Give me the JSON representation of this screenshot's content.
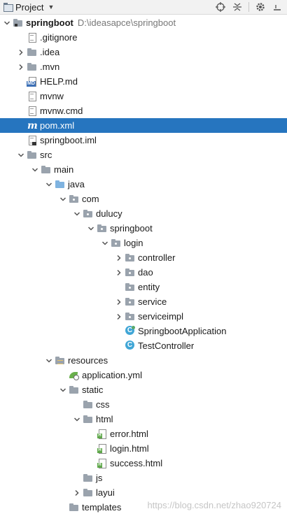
{
  "toolbar": {
    "title": "Project",
    "icons": [
      "project-icon",
      "dropdown-caret-icon",
      "crosshair-icon",
      "collapse-all-icon",
      "settings-gear-icon",
      "hide-icon"
    ]
  },
  "tree": [
    {
      "label": "springboot",
      "path": "D:\\ideasapce\\springboot",
      "depth": 0,
      "arrow": "down",
      "icon": "module-folder"
    },
    {
      "label": ".gitignore",
      "depth": 1,
      "arrow": "none",
      "icon": "text-file"
    },
    {
      "label": ".idea",
      "depth": 1,
      "arrow": "right",
      "icon": "folder"
    },
    {
      "label": ".mvn",
      "depth": 1,
      "arrow": "right",
      "icon": "folder"
    },
    {
      "label": "HELP.md",
      "depth": 1,
      "arrow": "none",
      "icon": "markdown-file"
    },
    {
      "label": "mvnw",
      "depth": 1,
      "arrow": "none",
      "icon": "text-file"
    },
    {
      "label": "mvnw.cmd",
      "depth": 1,
      "arrow": "none",
      "icon": "text-file"
    },
    {
      "label": "pom.xml",
      "depth": 1,
      "arrow": "none",
      "icon": "maven-file",
      "selected": true
    },
    {
      "label": "springboot.iml",
      "depth": 1,
      "arrow": "none",
      "icon": "iml-file"
    },
    {
      "label": "src",
      "depth": 1,
      "arrow": "down",
      "icon": "folder"
    },
    {
      "label": "main",
      "depth": 2,
      "arrow": "down",
      "icon": "folder"
    },
    {
      "label": "java",
      "depth": 3,
      "arrow": "down",
      "icon": "source-folder"
    },
    {
      "label": "com",
      "depth": 4,
      "arrow": "down",
      "icon": "package"
    },
    {
      "label": "dulucy",
      "depth": 5,
      "arrow": "down",
      "icon": "package"
    },
    {
      "label": "springboot",
      "depth": 6,
      "arrow": "down",
      "icon": "package"
    },
    {
      "label": "login",
      "depth": 7,
      "arrow": "down",
      "icon": "package"
    },
    {
      "label": "controller",
      "depth": 8,
      "arrow": "right",
      "icon": "package"
    },
    {
      "label": "dao",
      "depth": 8,
      "arrow": "right",
      "icon": "package"
    },
    {
      "label": "entity",
      "depth": 8,
      "arrow": "none",
      "icon": "package"
    },
    {
      "label": "service",
      "depth": 8,
      "arrow": "right",
      "icon": "package"
    },
    {
      "label": "serviceimpl",
      "depth": 8,
      "arrow": "right",
      "icon": "package"
    },
    {
      "label": "SpringbootApplication",
      "depth": 8,
      "arrow": "none",
      "icon": "spring-class"
    },
    {
      "label": "TestController",
      "depth": 8,
      "arrow": "none",
      "icon": "class"
    },
    {
      "label": "resources",
      "depth": 3,
      "arrow": "down",
      "icon": "resources-folder"
    },
    {
      "label": "application.yml",
      "depth": 4,
      "arrow": "none",
      "icon": "yml-file"
    },
    {
      "label": "static",
      "depth": 4,
      "arrow": "down",
      "icon": "folder"
    },
    {
      "label": "css",
      "depth": 5,
      "arrow": "none",
      "icon": "folder"
    },
    {
      "label": "html",
      "depth": 5,
      "arrow": "down",
      "icon": "folder"
    },
    {
      "label": "error.html",
      "depth": 6,
      "arrow": "none",
      "icon": "html-file"
    },
    {
      "label": "login.html",
      "depth": 6,
      "arrow": "none",
      "icon": "html-file"
    },
    {
      "label": "success.html",
      "depth": 6,
      "arrow": "none",
      "icon": "html-file"
    },
    {
      "label": "js",
      "depth": 5,
      "arrow": "none",
      "icon": "folder"
    },
    {
      "label": "layui",
      "depth": 5,
      "arrow": "right",
      "icon": "folder"
    },
    {
      "label": "templates",
      "depth": 4,
      "arrow": "none",
      "icon": "folder"
    }
  ],
  "watermark": "https://blog.csdn.net/zhao920724",
  "colors": {
    "selection": "#2675bf",
    "source_folder": "#7fb3e0",
    "class_icon": "#40a6d6"
  }
}
